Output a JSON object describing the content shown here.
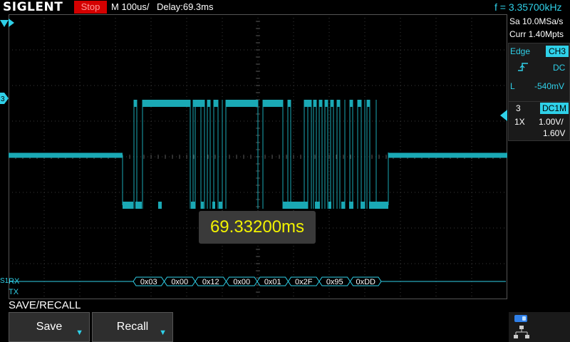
{
  "header": {
    "brand": "SIGLENT",
    "run_state": "Stop",
    "timebase": "M 100us/",
    "delay": "Delay:69.3ms",
    "frequency": "f = 3.35700kHz"
  },
  "acquisition": {
    "sample_rate": "Sa 10.0MSa/s",
    "memory_depth": "Curr 1.40Mpts"
  },
  "trigger": {
    "type": "Edge",
    "source": "CH3",
    "slope_icon": "rising-edge-icon",
    "coupling": "DC",
    "level_label": "L",
    "level": "-540mV"
  },
  "channel": {
    "number": "3",
    "coupling": "DC1M",
    "probe": "1X",
    "scale": "1.00V/",
    "offset": "1.60V"
  },
  "markers": {
    "channel_marker": "3",
    "decode_marker": "S1"
  },
  "decode": {
    "rx_label": "RX",
    "tx_label": "TX",
    "bytes": [
      "0x03",
      "0x00",
      "0x12",
      "0x00",
      "0x01",
      "0x2F",
      "0x95",
      "0xDD"
    ]
  },
  "measurement": {
    "delay_readout": "69.33200ms"
  },
  "menu": {
    "title": "SAVE/RECALL",
    "save_label": "Save",
    "recall_label": "Recall"
  },
  "colors": {
    "trace": "#1aa9b5",
    "accent": "#2fd0e8",
    "stop": "#d40000",
    "readout": "#f2f200"
  },
  "icons": {
    "usb": "usb-icon",
    "lan": "lan-icon"
  }
}
